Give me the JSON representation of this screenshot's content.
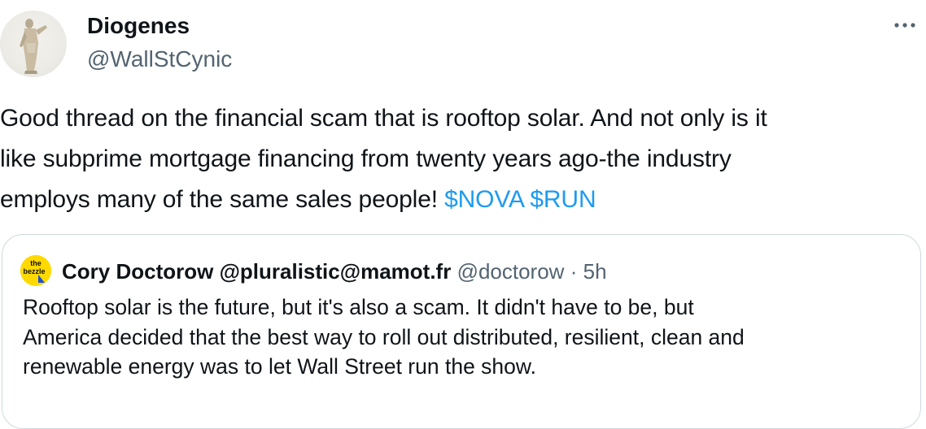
{
  "tweet": {
    "author": {
      "name": "Diogenes",
      "handle": "@WallStCynic",
      "avatar_icon": "statue-avatar"
    },
    "more_icon": "more-horizontal-icon",
    "text": {
      "part1": "Good thread on the financial scam that is rooftop solar. And not only is it\nlike subprime mortgage financing from twenty years ago-the industry\nemploys many of the same sales people! ",
      "cashtag1": "$NOVA",
      "sep": " ",
      "cashtag2": "$RUN"
    },
    "quoted": {
      "avatar_icon": "the-bezzle-logo",
      "avatar_text_top": "the",
      "avatar_text_bottom": "bezzle",
      "name": "Cory Doctorow @pluralistic@mamot.fr",
      "handle": "@doctorow",
      "dot": "·",
      "time": "5h",
      "text": "Rooftop solar is the future, but it's also a scam. It didn't have to be, but\nAmerica decided that the best way to roll out distributed, resilient, clean and\nrenewable energy was to let Wall Street run the show."
    }
  },
  "colors": {
    "text": "#0f1419",
    "secondary": "#536471",
    "link": "#1d9bf0",
    "border": "#cfd9de"
  }
}
